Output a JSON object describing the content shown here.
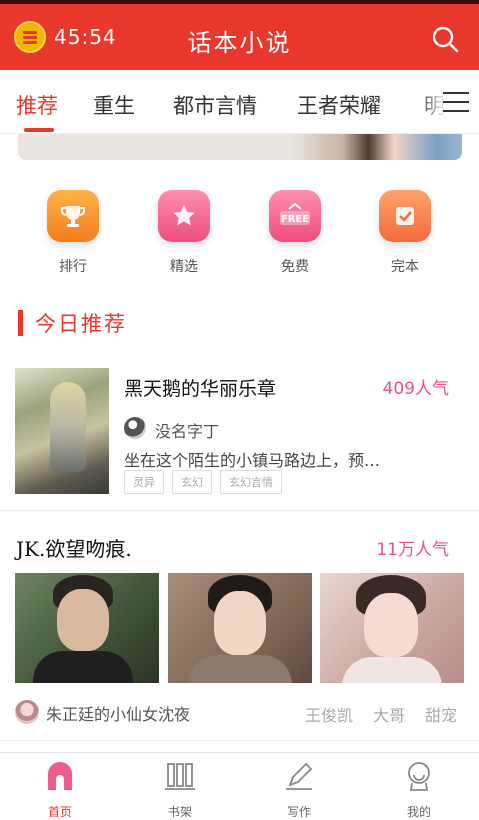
{
  "header": {
    "timer": "45:54",
    "title": "话本小说"
  },
  "tabs": [
    {
      "label": "推荐"
    },
    {
      "label": "重生"
    },
    {
      "label": "都市言情"
    },
    {
      "label": "王者荣耀"
    },
    {
      "label": "明"
    }
  ],
  "categories": [
    {
      "label": "排行",
      "icon": "trophy-icon"
    },
    {
      "label": "精选",
      "icon": "star-icon"
    },
    {
      "label": "免费",
      "icon": "free-icon"
    },
    {
      "label": "完本",
      "icon": "check-icon"
    }
  ],
  "section": {
    "title": "今日推荐"
  },
  "book": {
    "title": "黑天鹅的华丽乐章",
    "popularity": "409人气",
    "author": "没名字丁",
    "description": "坐在这个陌生的小镇马路边上，预…",
    "tags": [
      "灵异",
      "玄幻",
      "玄幻言情"
    ]
  },
  "booklist": {
    "title": "JK.欲望吻痕.",
    "popularity": "11万人气",
    "creator": "朱正廷的小仙女沈夜",
    "members": [
      "王俊凯",
      "大哥",
      "甜宠"
    ]
  },
  "bottom_nav": [
    {
      "label": "首页",
      "active": true
    },
    {
      "label": "书架"
    },
    {
      "label": "写作"
    },
    {
      "label": "我的"
    }
  ],
  "colors": {
    "brand": "#e8372c",
    "popularity": "#e8558a"
  }
}
